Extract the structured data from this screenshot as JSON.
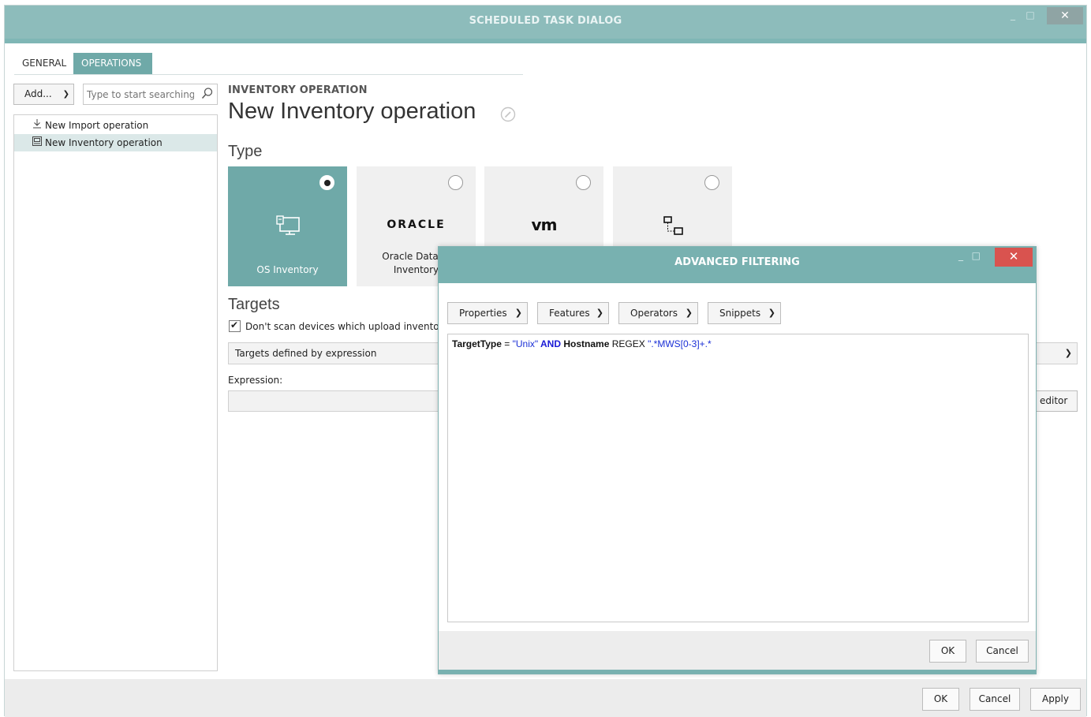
{
  "window": {
    "title": "SCHEDULED TASK DIALOG",
    "minimize_glyph": "_",
    "maximize_glyph": "□",
    "close_glyph": "✕"
  },
  "tabs": [
    {
      "label": "GENERAL",
      "active": false
    },
    {
      "label": "OPERATIONS",
      "active": true
    }
  ],
  "left_panel": {
    "add_button": "Add...",
    "search_placeholder": "Type to start searching...",
    "tree": [
      {
        "label": "New Import operation",
        "icon": "download-icon",
        "selected": false
      },
      {
        "label": "New Inventory operation",
        "icon": "inventory-icon",
        "selected": true
      }
    ]
  },
  "main": {
    "section_label": "INVENTORY OPERATION",
    "title": "New Inventory operation",
    "type_label": "Type",
    "type_cards": [
      {
        "name": "OS Inventory",
        "icon": "os-inventory-icon",
        "selected": true
      },
      {
        "name_line1": "Oracle Databa",
        "name_line2": "Inventory",
        "logo_text": "ORACLE",
        "selected": false
      },
      {
        "logo_text": "vm",
        "selected": false
      },
      {
        "icon": "network-icon",
        "selected": false
      }
    ],
    "targets_label": "Targets",
    "checkbox_label": "Don't scan devices which upload inventory",
    "checkbox_checked": true,
    "targets_select": "Targets defined by expression",
    "expression_label": "Expression:",
    "expression_value": "",
    "editor_button": "editor"
  },
  "footer": {
    "ok": "OK",
    "cancel": "Cancel",
    "apply": "Apply"
  },
  "dialog": {
    "title": "ADVANCED FILTERING",
    "toolbar": [
      "Properties",
      "Features",
      "Operators",
      "Snippets"
    ],
    "code": {
      "t1": "TargetType",
      "t2": " = ",
      "t3": "\"Unix\"",
      "t4": " AND ",
      "t5": "Hostname",
      "t6": " REGEX ",
      "t7": "\".*MWS[0-3]+.*"
    },
    "ok": "OK",
    "cancel": "Cancel"
  },
  "colors": {
    "accent": "#6fa9a8",
    "titlebar": "#8dbcbb",
    "close_red": "#d9534f"
  }
}
